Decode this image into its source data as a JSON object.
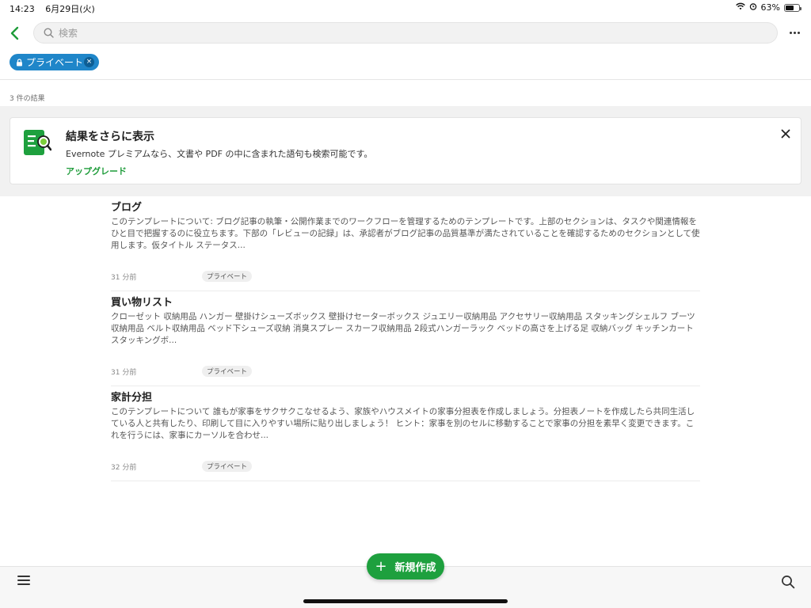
{
  "status_bar": {
    "time": "14:23",
    "date": "6月29日(火)",
    "battery_text": "63%",
    "battery_level": 0.63
  },
  "search": {
    "placeholder": "検索",
    "value": ""
  },
  "filter_chip": {
    "label": "プライベート",
    "remove_symbol": "×",
    "color": "#1f86c9"
  },
  "results": {
    "count_text": "3 件の結果"
  },
  "upsell": {
    "title": "結果をさらに表示",
    "description": "Evernote プレミアムなら、文書や PDF の中に含まれた語句も検索可能です。",
    "link_label": "アップグレード",
    "accent_color": "#1e9c3a"
  },
  "notes": [
    {
      "title": "ブログ",
      "snippet": "このテンプレートについて: ブログ記事の執筆・公開作業までのワークフローを管理するためのテンプレートです。上部のセクションは、タスクや関連情報をひと目で把握するのに役立ちます。下部の「レビューの記録」は、承認者がブログ記事の品質基準が満たされていることを確認するためのセクションとして使用します。仮タイトル ステータス...",
      "time": "31 分前",
      "tag": "プライベート"
    },
    {
      "title": "買い物リスト",
      "snippet": "クローゼット 収納用品 ハンガー 壁掛けシューズボックス 壁掛けセーターボックス ジュエリー収納用品 アクセサリー収納用品 スタッキングシェルフ ブーツ収納用品 ベルト収納用品 ベッド下シューズ収納 消臭スプレー スカーフ収納用品 2段式ハンガーラック ベッドの高さを上げる足 収納バッグ キッチンカート スタッキングボ...",
      "time": "31 分前",
      "tag": "プライベート"
    },
    {
      "title": "家計分担",
      "snippet": "このテンプレートについて 誰もが家事をサクサクこなせるよう、家族やハウスメイトの家事分担表を作成しましょう。分担表ノートを作成したら共同生活している人と共有したり、印刷して目に入りやすい場所に貼り出しましょう！ ヒント：家事を別のセルに移動することで家事の分担を素早く変更できます。これを行うには、家事にカーソルを合わせ...",
      "time": "32 分前",
      "tag": "プライベート"
    }
  ],
  "bottom_bar": {
    "new_button_label": "新規作成",
    "new_button_plus": "+",
    "accent_color": "#1ea03e"
  },
  "icons": [
    "back-chevron-icon",
    "search-icon",
    "more-icon",
    "lock-icon",
    "close-icon",
    "premium-search-icon",
    "menu-icon",
    "plus-icon",
    "wifi-icon",
    "alarm-icon",
    "battery-icon"
  ]
}
